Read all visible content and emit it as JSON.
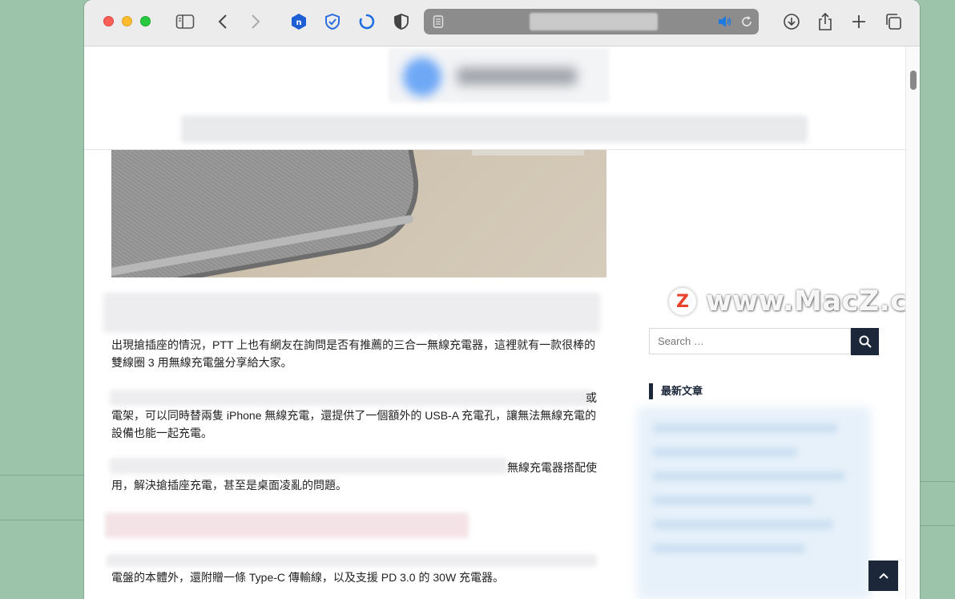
{
  "browser": {
    "icons": [
      "sidebar-icon",
      "back-icon",
      "forward-icon",
      "extension-shield-icon",
      "privacy-check-icon",
      "loading-spinner-icon",
      "shield-half-icon",
      "reader-icon",
      "audio-icon",
      "reload-icon",
      "download-icon",
      "share-icon",
      "new-tab-icon",
      "tab-overview-icon"
    ]
  },
  "article": {
    "para1": "出現搶插座的情況，PTT 上也有網友在詢問是否有推薦的三合一無線充電器，這裡就有一款很棒的雙線圈 3 用無線充電盤分享給大家。",
    "para2_line1_tail": "或",
    "para2_rest": "電架，可以同時替兩隻 iPhone 無線充電，還提供了一個額外的 USB-A 充電孔，讓無法無線充電的設備也能一起充電。",
    "para3_line1_tail": "無線充電器搭配使",
    "para3_rest": "用，解決搶插座充電，甚至是桌面凌亂的問題。",
    "para4_rest": "電盤的本體外，還附贈一條 Type-C 傳輸線，以及支援 PD 3.0 的 30W 充電器。"
  },
  "sidebar": {
    "search_placeholder": "Search …",
    "recent_heading": "最新文章"
  },
  "watermark": {
    "logo_letter": "Z",
    "text": "www.MacZ.com"
  },
  "colors": {
    "accent_dark": "#1c2739",
    "desktop_bg": "#9cc4ab"
  }
}
